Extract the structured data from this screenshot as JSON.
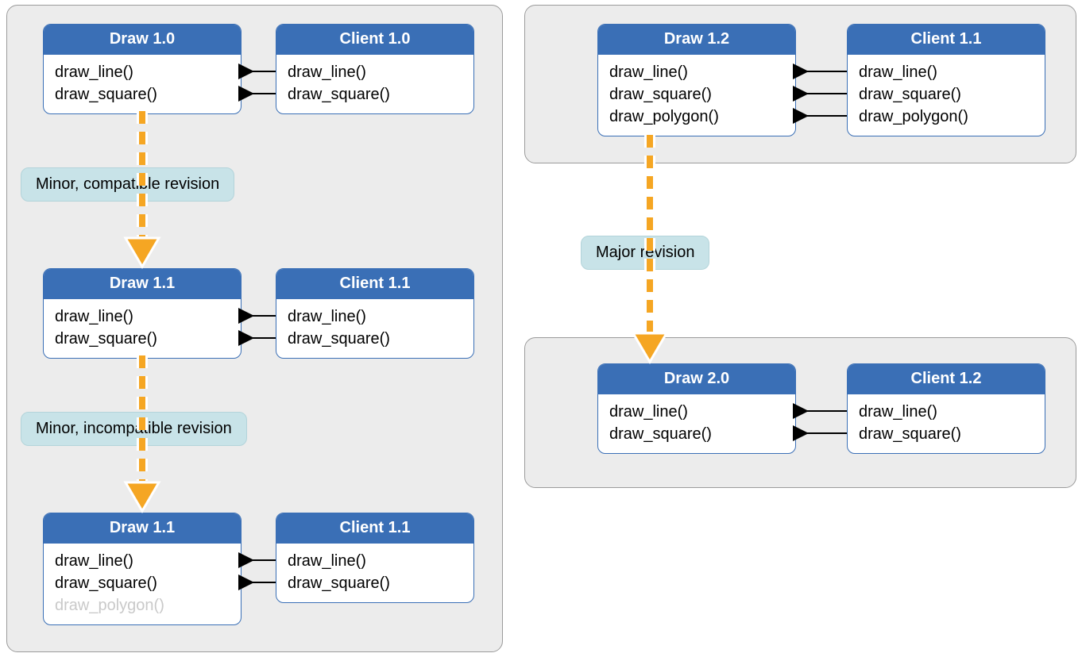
{
  "left_panel": {
    "row1": {
      "draw": {
        "title": "Draw 1.0",
        "methods": [
          "draw_line()",
          "draw_square()"
        ]
      },
      "client": {
        "title": "Client 1.0",
        "methods": [
          "draw_line()",
          "draw_square()"
        ]
      }
    },
    "rev_label_1": "Minor, compatible revision",
    "row2": {
      "draw": {
        "title": "Draw 1.1",
        "methods": [
          "draw_line()",
          "draw_square()"
        ]
      },
      "client": {
        "title": "Client 1.1",
        "methods": [
          "draw_line()",
          "draw_square()"
        ]
      }
    },
    "rev_label_2": "Minor, incompatible revision",
    "row3": {
      "draw": {
        "title": "Draw 1.1",
        "methods": [
          "draw_line()",
          "draw_square()",
          "draw_polygon()"
        ]
      },
      "client": {
        "title": "Client 1.1",
        "methods": [
          "draw_line()",
          "draw_square()"
        ]
      }
    }
  },
  "right_top_panel": {
    "draw": {
      "title": "Draw 1.2",
      "methods": [
        "draw_line()",
        "draw_square()",
        "draw_polygon()"
      ]
    },
    "client": {
      "title": "Client 1.1",
      "methods": [
        "draw_line()",
        "draw_square()",
        "draw_polygon()"
      ]
    }
  },
  "rev_label_major": "Major revision",
  "right_bottom_panel": {
    "draw": {
      "title": "Draw 2.0",
      "methods": [
        "draw_line()",
        "draw_square()"
      ]
    },
    "client": {
      "title": "Client 1.2",
      "methods": [
        "draw_line()",
        "draw_square()"
      ]
    }
  }
}
